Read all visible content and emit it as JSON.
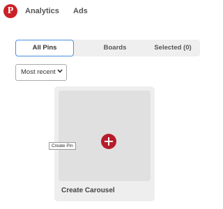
{
  "nav": {
    "logo_icon": "pinterest-logo-icon",
    "brand_color": "#cb2027",
    "links": [
      "Analytics",
      "Ads"
    ]
  },
  "tabs": {
    "items": [
      "All Pins",
      "Boards",
      "Selected (0)"
    ],
    "active_index": 0,
    "active_border_color": "#4a90e2"
  },
  "sort": {
    "selected": "Most recent",
    "icon": "chevron-down-icon"
  },
  "card": {
    "title": "Create Carousel",
    "action_icon": "plus-icon",
    "action_color": "#b71c2b",
    "tooltip": "Create Pin"
  }
}
